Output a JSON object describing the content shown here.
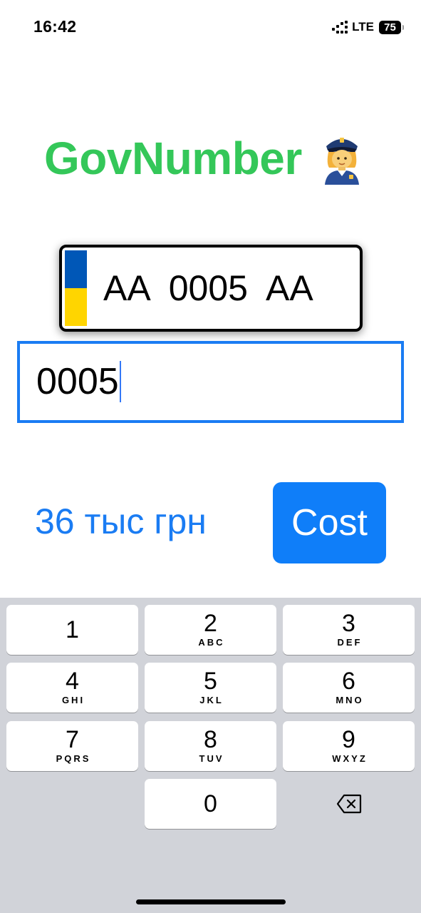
{
  "status_bar": {
    "time": "16:42",
    "network": "LTE",
    "battery": "75",
    "icons": [
      "signal-icon",
      "battery-icon"
    ]
  },
  "app": {
    "title": "GovNumber",
    "title_color": "#34c759",
    "title_emoji_icon": "police-officer-icon"
  },
  "plate": {
    "text": "AA  0005  AA",
    "flag_colors": [
      "#0057b7",
      "#ffd500"
    ]
  },
  "input": {
    "value": "0005",
    "border_color": "#1a7cf3"
  },
  "result": {
    "price": "36 тыс грн"
  },
  "cost_button": {
    "label": "Cost",
    "color": "#0f7ef9"
  },
  "keyboard": {
    "keys": [
      {
        "digit": "1",
        "letters": ""
      },
      {
        "digit": "2",
        "letters": "ABC"
      },
      {
        "digit": "3",
        "letters": "DEF"
      },
      {
        "digit": "4",
        "letters": "GHI"
      },
      {
        "digit": "5",
        "letters": "JKL"
      },
      {
        "digit": "6",
        "letters": "MNO"
      },
      {
        "digit": "7",
        "letters": "PQRS"
      },
      {
        "digit": "8",
        "letters": "TUV"
      },
      {
        "digit": "9",
        "letters": "WXYZ"
      },
      {
        "digit": "0",
        "letters": ""
      }
    ],
    "delete_icon": "backspace-icon"
  }
}
